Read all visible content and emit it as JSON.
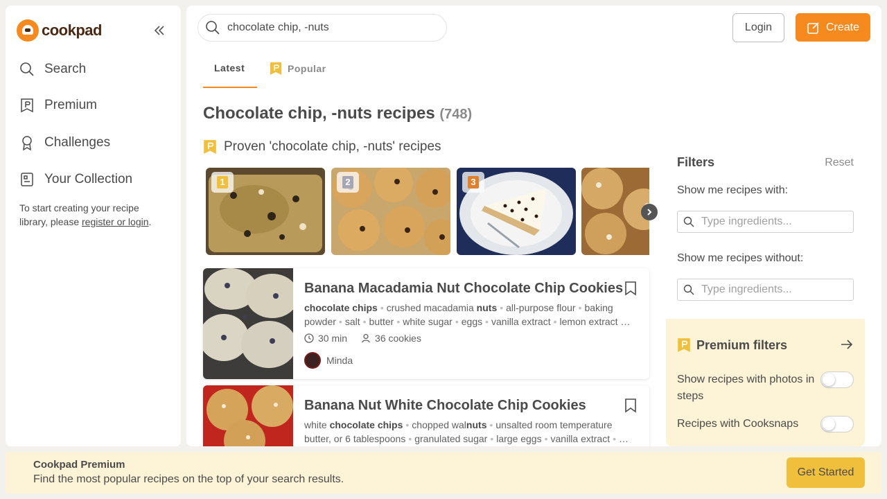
{
  "brand": {
    "name": "cookpad",
    "accent": "#f68a1e",
    "premium_gold": "#f0bf3c"
  },
  "sidebar": {
    "collapse_icon": "double-chevron-left-icon",
    "items": [
      {
        "label": "Search",
        "icon": "search-icon"
      },
      {
        "label": "Premium",
        "icon": "premium-bookmark-icon"
      },
      {
        "label": "Challenges",
        "icon": "award-icon"
      },
      {
        "label": "Your Collection",
        "icon": "collection-icon"
      }
    ],
    "note_prefix": "To start creating your recipe library, please ",
    "note_link": "register or login",
    "note_suffix": "."
  },
  "header": {
    "search_value": "chocolate chip, -nuts",
    "login_label": "Login",
    "create_label": "Create"
  },
  "tabs": [
    {
      "label": "Latest",
      "active": true
    },
    {
      "label": "Popular",
      "active": false
    }
  ],
  "results": {
    "query_bold": "Chocolate chip, -nuts",
    "suffix": " recipes",
    "count": "(748)"
  },
  "proven": {
    "label": "Proven 'chocolate chip, -nuts' recipes",
    "thumbnails": [
      {
        "rank": "1",
        "rank_color": "#f0bf3c",
        "photo": "banana-bread"
      },
      {
        "rank": "2",
        "rank_color": "#a6a6b4",
        "photo": "cookies"
      },
      {
        "rank": "3",
        "rank_color": "#e0802a",
        "photo": "cream-pie"
      },
      {
        "rank": "",
        "rank_color": "",
        "photo": "cookies-white-chip"
      }
    ]
  },
  "recipes": [
    {
      "title": "Banana Macadamia Nut Chocolate Chip Cookies",
      "ingredients": [
        {
          "parts": [
            {
              "t": "chocolate chips",
              "b": true
            }
          ]
        },
        {
          "parts": [
            {
              "t": "crushed macadamia ",
              "b": false
            },
            {
              "t": "nuts",
              "b": true
            }
          ]
        },
        {
          "parts": [
            {
              "t": "all-purpose flour",
              "b": false
            }
          ]
        },
        {
          "parts": [
            {
              "t": "baking powder",
              "b": false
            }
          ]
        },
        {
          "parts": [
            {
              "t": "salt",
              "b": false
            }
          ]
        },
        {
          "parts": [
            {
              "t": "butter",
              "b": false
            }
          ]
        },
        {
          "parts": [
            {
              "t": "white sugar",
              "b": false
            }
          ]
        },
        {
          "parts": [
            {
              "t": "eggs",
              "b": false
            }
          ]
        },
        {
          "parts": [
            {
              "t": "vanilla extract",
              "b": false
            }
          ]
        },
        {
          "parts": [
            {
              "t": "lemon extract …",
              "b": false
            }
          ]
        }
      ],
      "time": "30 min",
      "servings": "36 cookies",
      "author": "Minda"
    },
    {
      "title": "Banana Nut White Chocolate Chip Cookies",
      "ingredients": [
        {
          "parts": [
            {
              "t": "white ",
              "b": false
            },
            {
              "t": "chocolate chips",
              "b": true
            }
          ]
        },
        {
          "parts": [
            {
              "t": "chopped wal",
              "b": false
            },
            {
              "t": "nuts",
              "b": true
            }
          ]
        },
        {
          "parts": [
            {
              "t": "unsalted room temperature butter, or 6 tablespoons",
              "b": false
            }
          ]
        },
        {
          "parts": [
            {
              "t": "granulated sugar",
              "b": false
            }
          ]
        },
        {
          "parts": [
            {
              "t": "large eggs",
              "b": false
            }
          ]
        },
        {
          "parts": [
            {
              "t": "vanilla extract",
              "b": false
            }
          ]
        },
        {
          "parts": [
            {
              "t": "…",
              "b": false
            }
          ]
        }
      ],
      "time": "",
      "servings": "",
      "author": ""
    }
  ],
  "filters": {
    "title": "Filters",
    "reset": "Reset",
    "with_label": "Show me recipes with:",
    "with_placeholder": "Type ingredients...",
    "without_label": "Show me recipes without:",
    "without_placeholder": "Type ingredients...",
    "premium_title": "Premium filters",
    "premium_rows": [
      {
        "label": "Show recipes with photos in steps",
        "on": false
      },
      {
        "label": "Recipes with Cooksnaps",
        "on": false
      }
    ]
  },
  "banner": {
    "title": "Cookpad Premium",
    "text": "Find the most popular recipes on the top of your search results.",
    "cta": "Get Started"
  }
}
